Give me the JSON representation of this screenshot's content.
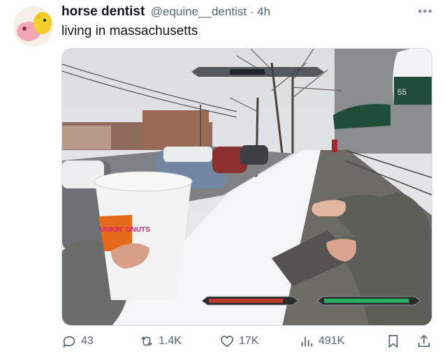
{
  "tweet": {
    "display_name": "horse dentist",
    "handle_line": "@equine__dentist · 4h",
    "text": "living in massachusetts",
    "more_icon": "more-horizontal-icon"
  },
  "media": {
    "cup_brand": "UNKIN' ONUTS",
    "sign_number": "55",
    "hud": {
      "compass": "compass-bar",
      "health": 0.9,
      "stamina": 0.95,
      "health_color": "#c0392b",
      "stamina_color": "#27ae60"
    }
  },
  "actions": {
    "replies": "43",
    "reposts": "1.4K",
    "likes": "17K",
    "views": "491K",
    "icons": [
      "reply-icon",
      "repost-icon",
      "like-icon",
      "views-icon",
      "bookmark-icon",
      "share-icon"
    ]
  },
  "colors": {
    "text_primary": "#0f1419",
    "text_secondary": "#536471",
    "accent": "#1d9bf0"
  }
}
